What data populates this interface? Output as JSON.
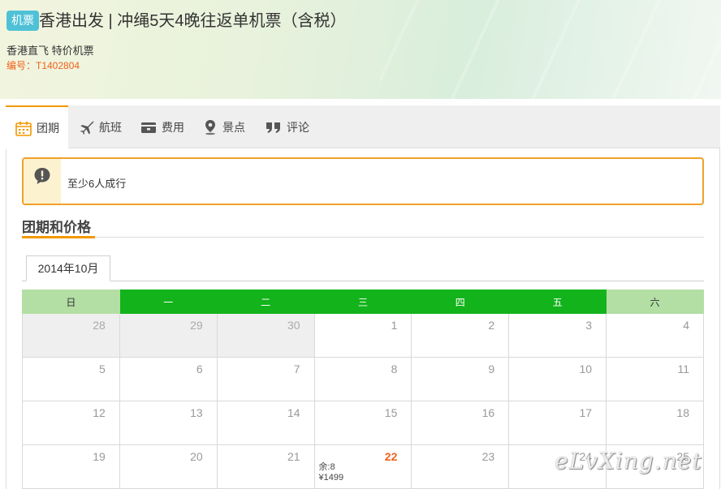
{
  "header": {
    "badge": "机票",
    "title": "香港出发 | 冲绳5天4晚往返单机票（含税）",
    "subtitle": "香港直飞 特价机票",
    "code": "编号：T1402804"
  },
  "tabs": [
    {
      "label": "团期",
      "icon": "calendar-icon",
      "active": true
    },
    {
      "label": "航班",
      "icon": "airplane-icon"
    },
    {
      "label": "费用",
      "icon": "wallet-icon"
    },
    {
      "label": "景点",
      "icon": "location-pin-icon"
    },
    {
      "label": "评论",
      "icon": "quote-icon"
    }
  ],
  "notice": {
    "text": "至少6人成行",
    "icon": "exclamation-icon"
  },
  "section": {
    "title": "团期和价格"
  },
  "month_tab": {
    "label": "2014年10月"
  },
  "calendar": {
    "weekdays": [
      "日",
      "一",
      "二",
      "三",
      "四",
      "五",
      "六"
    ],
    "weeks": [
      [
        {
          "d": "28",
          "other": true
        },
        {
          "d": "29",
          "other": true
        },
        {
          "d": "30",
          "other": true
        },
        {
          "d": "1"
        },
        {
          "d": "2"
        },
        {
          "d": "3"
        },
        {
          "d": "4"
        }
      ],
      [
        {
          "d": "5"
        },
        {
          "d": "6"
        },
        {
          "d": "7"
        },
        {
          "d": "8"
        },
        {
          "d": "9"
        },
        {
          "d": "10"
        },
        {
          "d": "11"
        }
      ],
      [
        {
          "d": "12"
        },
        {
          "d": "13"
        },
        {
          "d": "14"
        },
        {
          "d": "15"
        },
        {
          "d": "16"
        },
        {
          "d": "17"
        },
        {
          "d": "18"
        }
      ],
      [
        {
          "d": "19"
        },
        {
          "d": "20"
        },
        {
          "d": "21"
        },
        {
          "d": "22",
          "hot": true,
          "remain": "余:8",
          "price": "¥1499"
        },
        {
          "d": "23"
        },
        {
          "d": "24"
        },
        {
          "d": "25"
        }
      ]
    ]
  },
  "watermark": "eLvXing.net",
  "colors": {
    "accent_orange": "#f39800",
    "weekday_green": "#13b31b",
    "weekend_green": "#b3dea4",
    "badge_blue": "#4fc1d7",
    "price_orange": "#f0621b"
  }
}
